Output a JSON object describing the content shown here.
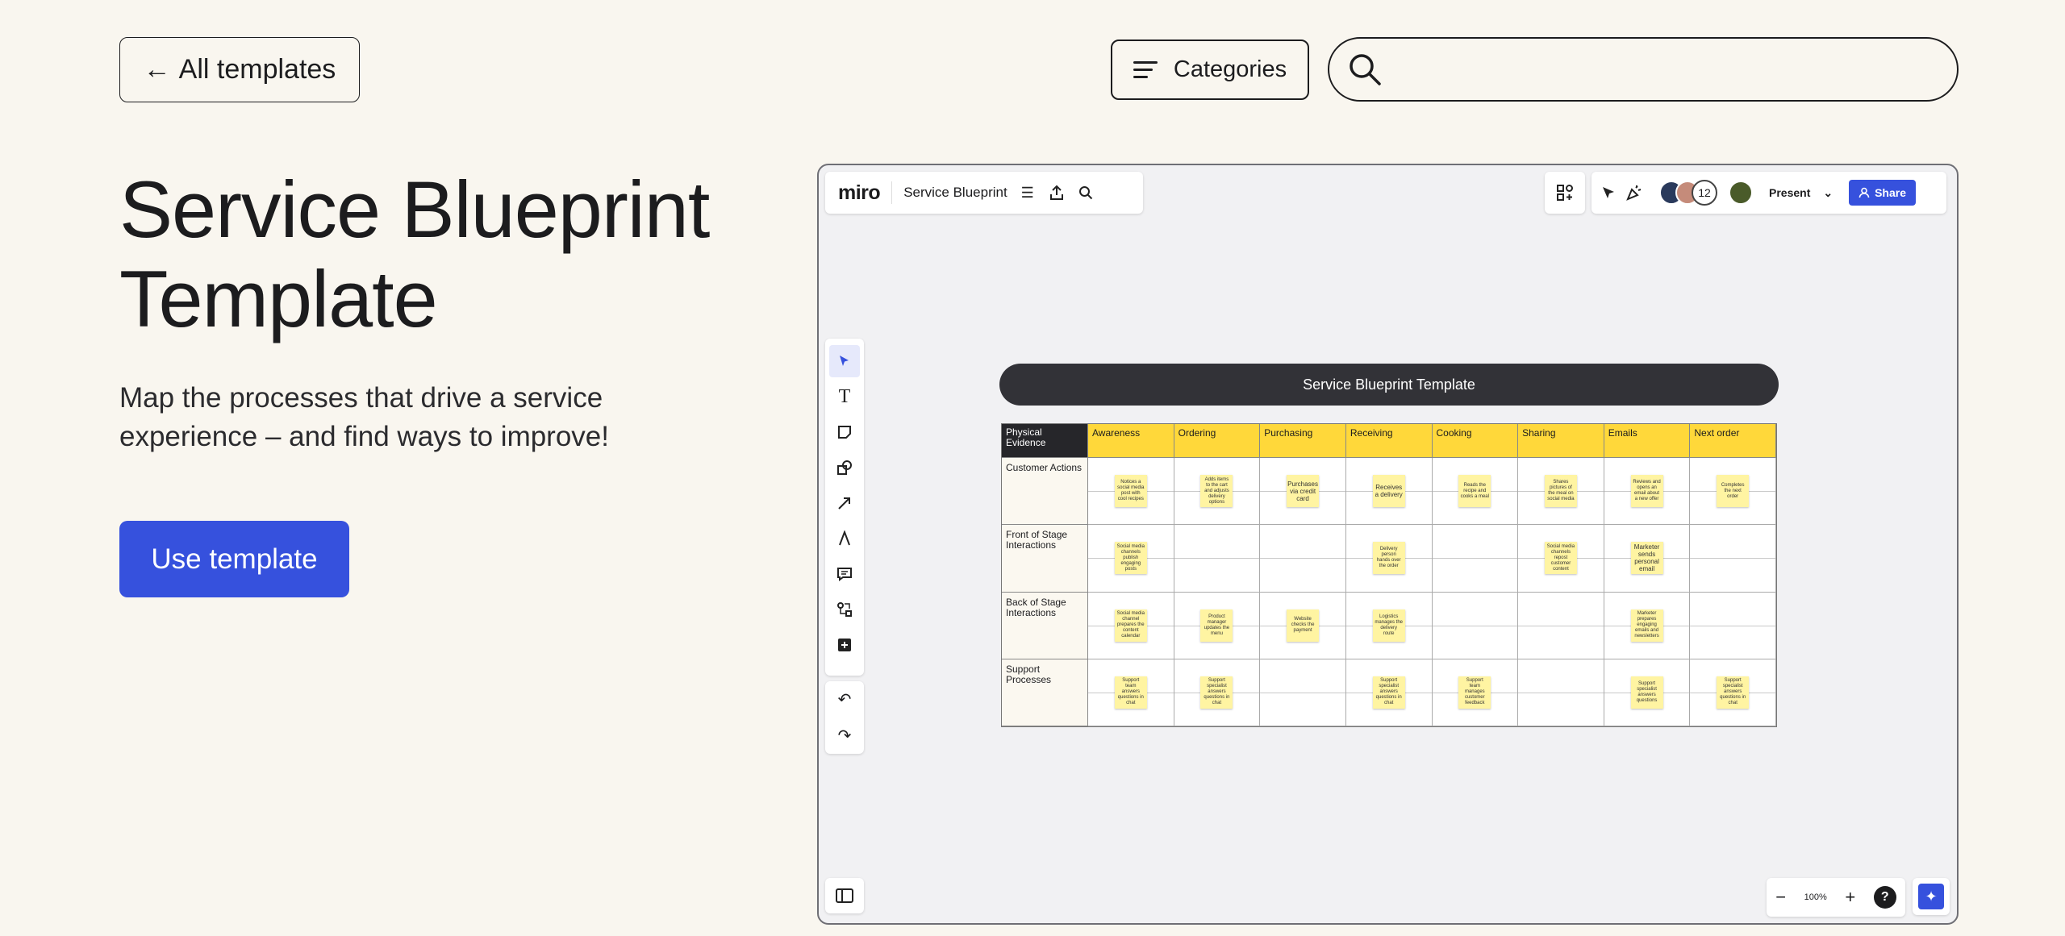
{
  "nav": {
    "back_arrow": "←",
    "back_label": "All templates",
    "categories_label": "Categories",
    "search_placeholder": ""
  },
  "hero": {
    "title": "Service Blueprint Template",
    "description": "Map the processes that drive a service experience – and find ways to improve!",
    "cta": "Use template",
    "accent_color": "#3651dd"
  },
  "board": {
    "logo": "miro",
    "board_name": "Service Blueprint",
    "collaborator_count": "12",
    "present_label": "Present",
    "share_label": "Share",
    "zoom": "100%",
    "help": "?",
    "blueprint_title": "Service Blueprint Template",
    "columns": [
      "Physical Evidence",
      "Awareness",
      "Ordering",
      "Purchasing",
      "Receiving",
      "Cooking",
      "Sharing",
      "Emails",
      "Next order"
    ],
    "rows": [
      {
        "label": "Customer Actions",
        "notes": [
          "Notices a social media post with cool recipes",
          "Adds items to the cart and adjusts delivery options",
          "Purchases via credit card",
          "Receives a delivery",
          "Reads the recipe and cooks a meal",
          "Shares pictures of the meal on social media",
          "Reviews and opens an email about a new offer",
          "Completes the next order"
        ]
      },
      {
        "label": "Front of Stage Interactions",
        "notes": [
          "Social media channels publish engaging posts",
          "",
          "",
          "Delivery person hands over the order",
          "",
          "Social media channels repost customer content",
          "Marketer sends personal email",
          ""
        ]
      },
      {
        "label": "Back of Stage Interactions",
        "notes": [
          "Social media channel prepares the content calendar",
          "Product manager updates the menu",
          "Website checks the payment",
          "Logistics manages the delivery route",
          "",
          "",
          "Marketer prepares engaging emails and newsletters",
          ""
        ]
      },
      {
        "label": "Support Processes",
        "notes": [
          "Support team answers questions in chat",
          "Support specialist answers questions in chat",
          "",
          "Support specialist answers questions in chat",
          "Support team manages customer feedback",
          "",
          "Support specialist answers questions",
          "Support specialist answers questions in chat"
        ]
      }
    ]
  }
}
